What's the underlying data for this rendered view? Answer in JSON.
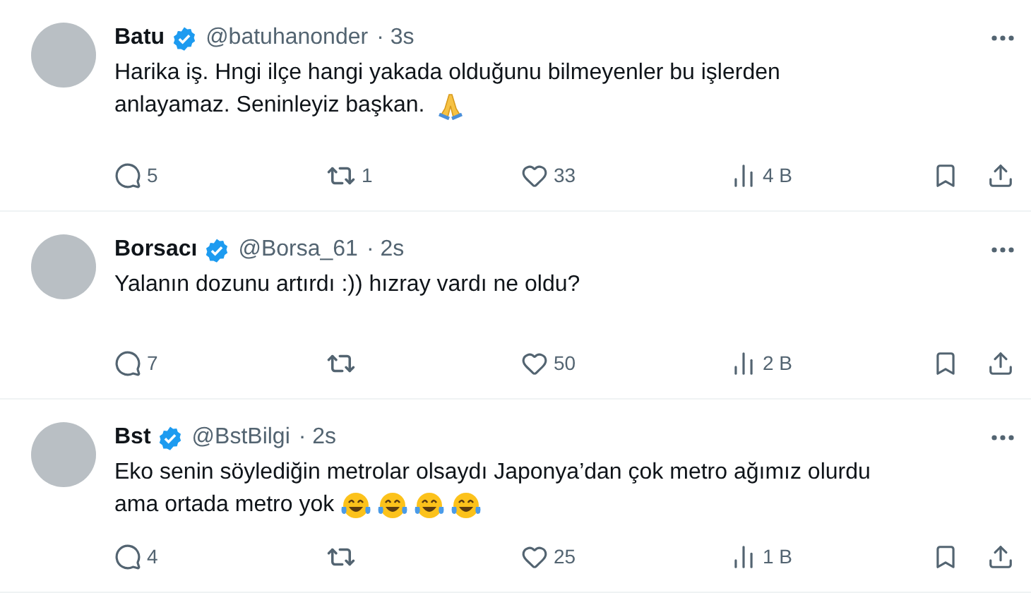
{
  "tweets": [
    {
      "name": "Batu",
      "handle": "@batuhanonder",
      "time": "· 3s",
      "verified": true,
      "lines": [
        "Harika iş. Hngi ilçe hangi yakada olduğunu bilmeyenler bu işlerden",
        "anlayamaz. Seninleyiz başkan."
      ],
      "emojis": [
        {
          "kind": "folded-hands"
        }
      ],
      "replies": "5",
      "reposts": "1",
      "likes": "33",
      "views": "4 B"
    },
    {
      "name": "Borsacı",
      "handle": "@Borsa_61",
      "time": "· 2s",
      "verified": true,
      "lines": [
        "Yalanın dozunu artırdı :)) hızray vardı ne oldu?"
      ],
      "replies": "7",
      "likes": "50",
      "views": "2 B"
    },
    {
      "name": "Bst",
      "handle": "@BstBilgi",
      "time": "· 2s",
      "verified": true,
      "lines": [
        "Eko senin söylediğin metrolar olsaydı Japonya’dan çok metro ağımız olurdu",
        "ama ortada metro yok"
      ],
      "emojis": [
        {
          "kind": "tears-of-joy"
        },
        {
          "kind": "tears-of-joy"
        },
        {
          "kind": "tears-of-joy"
        },
        {
          "kind": "tears-of-joy"
        }
      ],
      "replies": "4",
      "likes": "25",
      "views": "1 B"
    }
  ]
}
